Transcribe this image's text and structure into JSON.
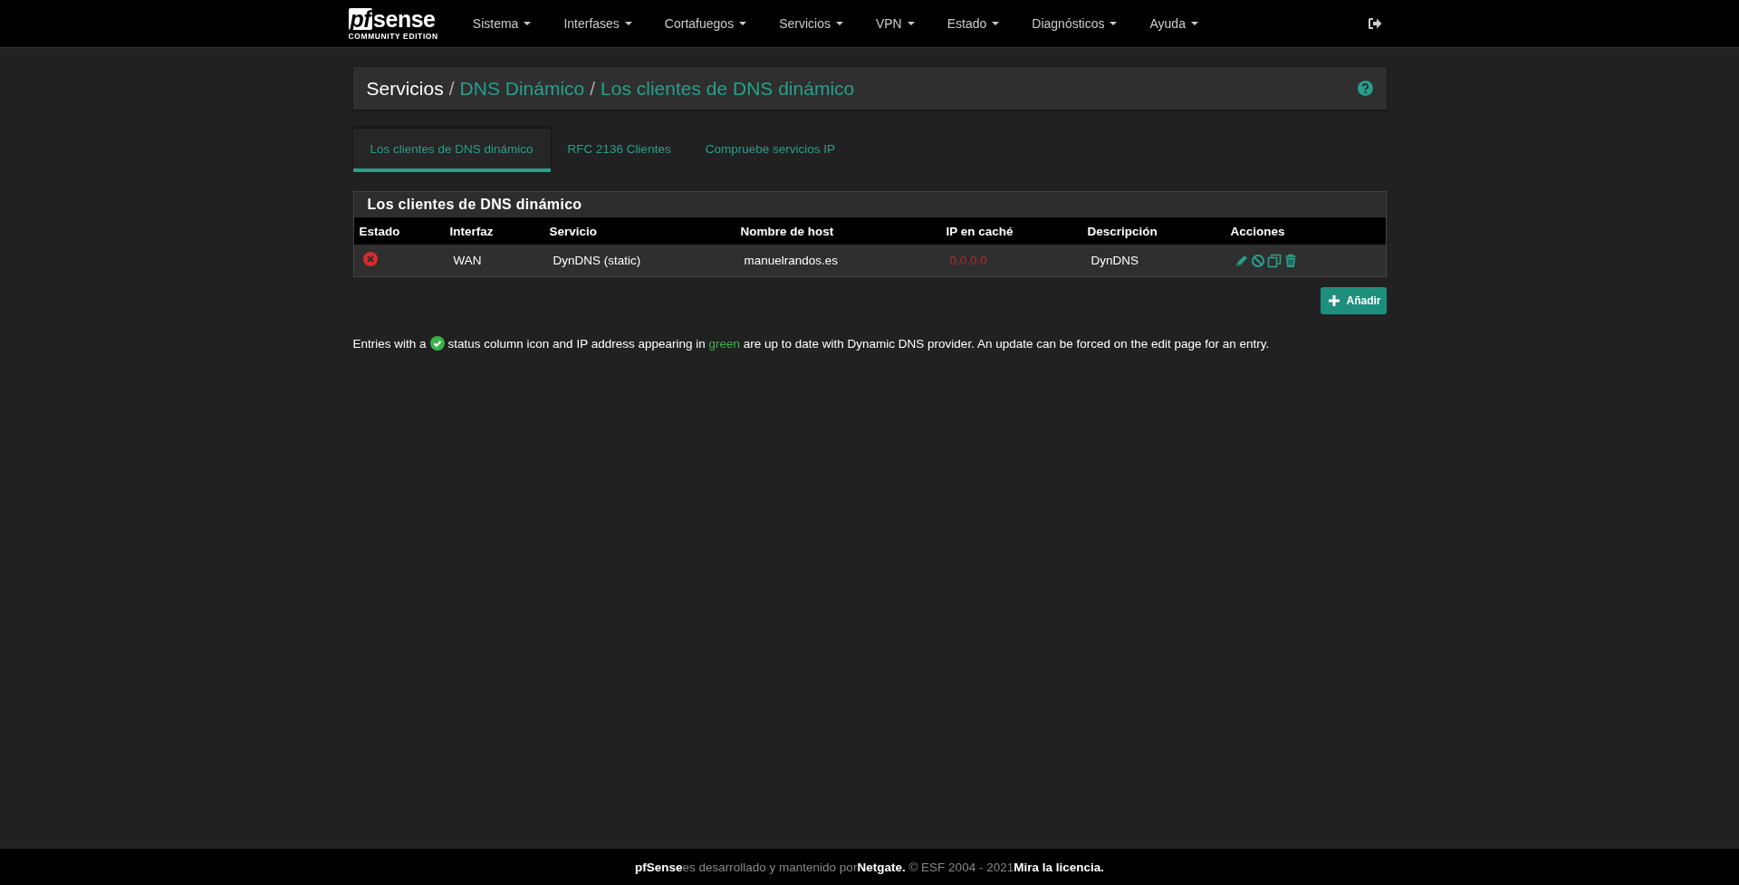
{
  "navbar": {
    "logo": {
      "wordmark_a": "pf",
      "wordmark_b": "sense",
      "edition": "COMMUNITY EDITION"
    },
    "menus": [
      {
        "label": "Sistema"
      },
      {
        "label": "Interfases"
      },
      {
        "label": "Cortafuegos"
      },
      {
        "label": "Servicios"
      },
      {
        "label": "VPN"
      },
      {
        "label": "Estado"
      },
      {
        "label": "Diagnósticos"
      },
      {
        "label": "Ayuda"
      }
    ]
  },
  "breadcrumb": {
    "separator": "/",
    "items": [
      "Servicios",
      "DNS Dinámico",
      "Los clientes de DNS dinámico"
    ]
  },
  "tabs": [
    {
      "label": "Los clientes de DNS dinámico",
      "selected": true
    },
    {
      "label": "RFC 2136 Clientes",
      "selected": false
    },
    {
      "label": "Compruebe servicios IP",
      "selected": false
    }
  ],
  "panel": {
    "title": "Los clientes de DNS dinámico",
    "columns": [
      "Estado",
      "Interfaz",
      "Servicio",
      "Nombre de host",
      "IP en caché",
      "Descripción",
      "Acciones"
    ],
    "rows": [
      {
        "up_to_date": false,
        "interface": "WAN",
        "service": "DynDNS (static)",
        "hostname": "manuelrandos.es",
        "cached_ip": "0.0.0.0",
        "description": "DynDNS"
      }
    ]
  },
  "add_button": "Añadir",
  "note": {
    "before": "Entries with a",
    "middle": "status column icon and IP address appearing in",
    "highlight": "green",
    "after": "are up to date with Dynamic DNS provider. An update can be forced on the edit page for an entry."
  },
  "footer": {
    "brand": "pfSense",
    "text_1": "es desarrollado y mantenido por",
    "link_1": "Netgate.",
    "text_2": " © ESF 2004 - 2021",
    "link_2": "Mira la licencia."
  }
}
